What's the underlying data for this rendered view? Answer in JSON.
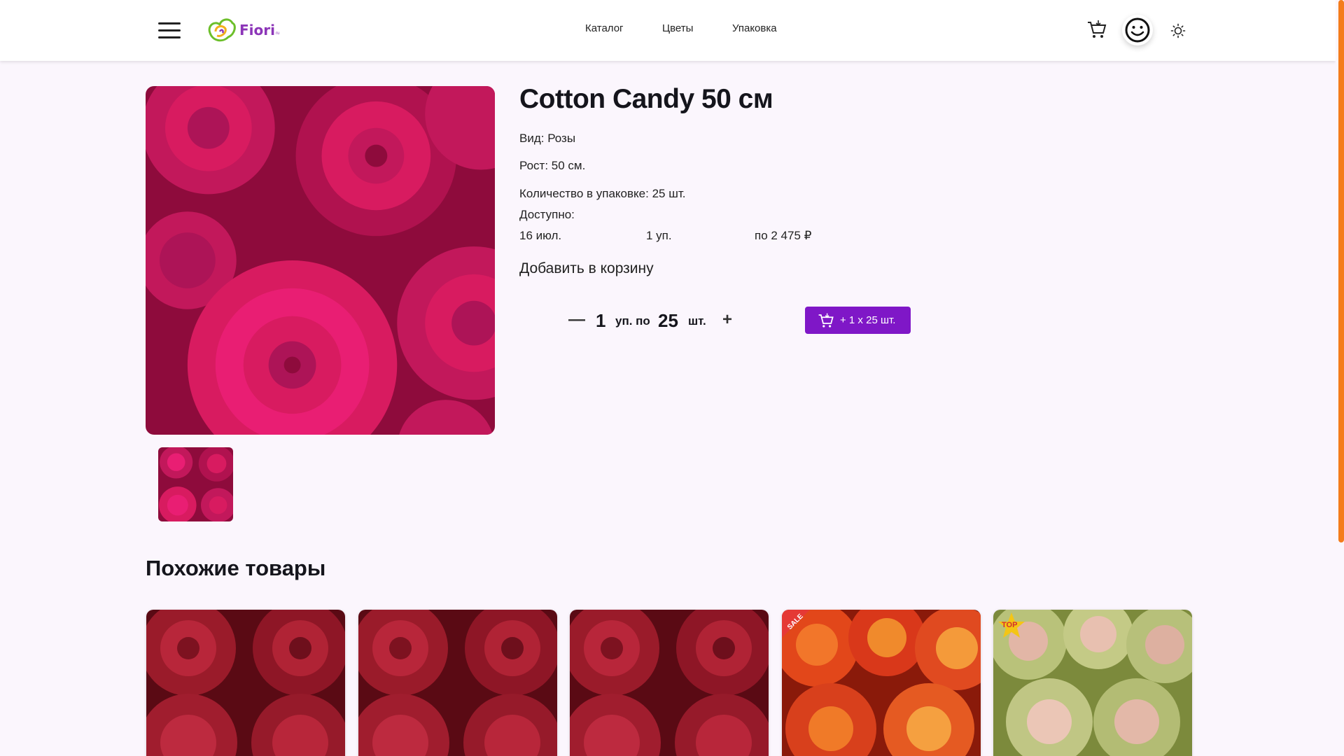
{
  "colors": {
    "accent": "#7f17c7",
    "logo": "#8c35b8",
    "background": "#fbf6fd",
    "scrollbar": "#f47c1c"
  },
  "header": {
    "logo_text": "Fiori",
    "logo_sub": "ru",
    "nav": [
      "Каталог",
      "Цветы",
      "Упаковка"
    ],
    "icons": [
      "menu-icon",
      "cart-icon",
      "profile-smiley-icon",
      "theme-sun-icon"
    ]
  },
  "product": {
    "title": "Cotton Candy 50 см",
    "kind": "Вид: Розы",
    "height": "Рост: 50 см.",
    "pack_qty": "Количество в упаковке: 25 шт.",
    "available_label": "Доступно:",
    "availability": {
      "date": "16 июл.",
      "units": "1 уп.",
      "price": "по 2 475 ₽"
    },
    "add_to_cart_label": "Добавить в корзину",
    "quantity": {
      "minus": "—",
      "packs": "1",
      "packs_unit": "уп. по",
      "per_pack": "25",
      "per_pack_unit": "шт.",
      "plus": "+"
    },
    "cart_button_label": "+ 1 x 25 шт."
  },
  "similar": {
    "title": "Похожие товары",
    "cards": [
      {
        "kind": "red-roses",
        "badge": ""
      },
      {
        "kind": "red-roses",
        "badge": ""
      },
      {
        "kind": "red-roses",
        "badge": ""
      },
      {
        "kind": "orange-roses",
        "badge": "SALE"
      },
      {
        "kind": "cream-roses",
        "badge": "TOP"
      }
    ]
  }
}
